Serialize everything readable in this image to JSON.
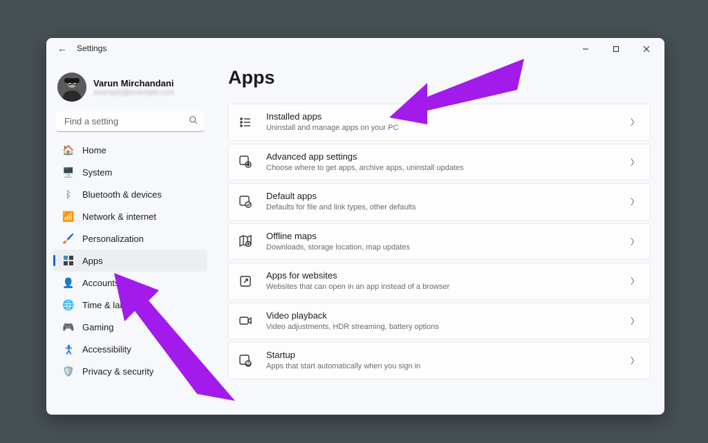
{
  "window": {
    "app_name": "Settings"
  },
  "profile": {
    "name": "Varun Mirchandani",
    "email_blurred": "example@example.com"
  },
  "search": {
    "placeholder": "Find a setting"
  },
  "nav": {
    "items": [
      {
        "id": "home",
        "label": "Home"
      },
      {
        "id": "system",
        "label": "System"
      },
      {
        "id": "bluetooth",
        "label": "Bluetooth & devices"
      },
      {
        "id": "network",
        "label": "Network & internet"
      },
      {
        "id": "personalization",
        "label": "Personalization"
      },
      {
        "id": "apps",
        "label": "Apps",
        "active": true
      },
      {
        "id": "accounts",
        "label": "Accounts"
      },
      {
        "id": "time",
        "label": "Time & language"
      },
      {
        "id": "gaming",
        "label": "Gaming"
      },
      {
        "id": "accessibility",
        "label": "Accessibility"
      },
      {
        "id": "privacy",
        "label": "Privacy & security"
      }
    ]
  },
  "page": {
    "title": "Apps",
    "cards": [
      {
        "id": "installed",
        "title": "Installed apps",
        "subtitle": "Uninstall and manage apps on your PC"
      },
      {
        "id": "advanced",
        "title": "Advanced app settings",
        "subtitle": "Choose where to get apps, archive apps, uninstall updates"
      },
      {
        "id": "default",
        "title": "Default apps",
        "subtitle": "Defaults for file and link types, other defaults"
      },
      {
        "id": "offline",
        "title": "Offline maps",
        "subtitle": "Downloads, storage location, map updates"
      },
      {
        "id": "websites",
        "title": "Apps for websites",
        "subtitle": "Websites that can open in an app instead of a browser"
      },
      {
        "id": "video",
        "title": "Video playback",
        "subtitle": "Video adjustments, HDR streaming, battery options"
      },
      {
        "id": "startup",
        "title": "Startup",
        "subtitle": "Apps that start automatically when you sign in"
      }
    ]
  },
  "annotations": {
    "note": "Two purple overlay arrows point at (1) the Apps sidebar item and (2) the Installed apps card."
  },
  "colors": {
    "accent": "#a31bea",
    "selection": "#1368ce"
  }
}
